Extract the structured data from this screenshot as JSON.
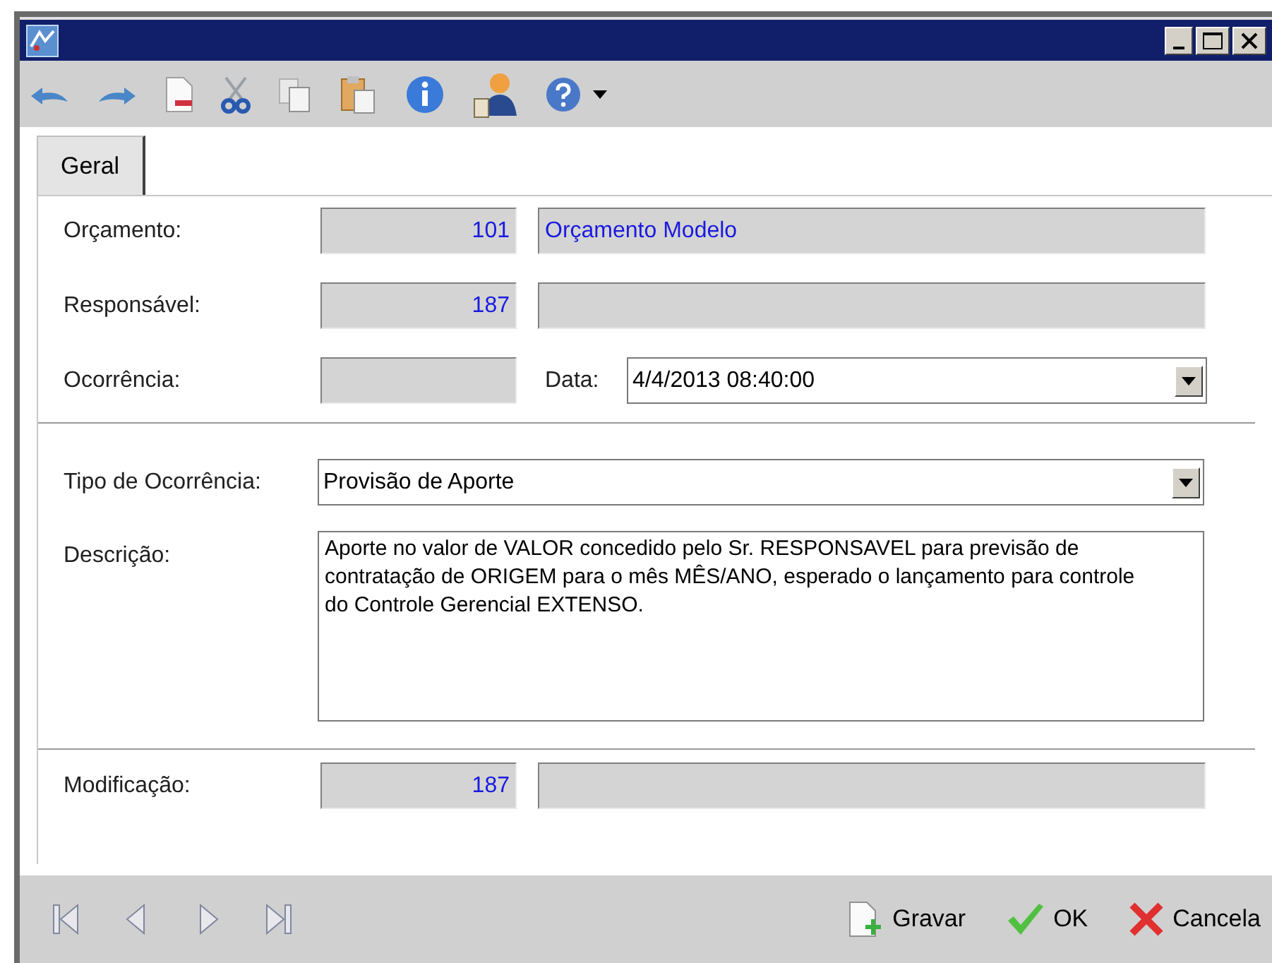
{
  "tabs": [
    {
      "label": "Geral",
      "selected": true
    }
  ],
  "rows": [
    {
      "kind": "code_name",
      "label": "Orçamento:",
      "code": "101",
      "name": "Orçamento Modelo"
    },
    {
      "kind": "code_name",
      "label": "Responsável:",
      "code": "187"
    },
    {
      "kind": "code_date",
      "label": "Ocorrência:",
      "date_label": "Data:",
      "date": "4/4/2013 08:40:00"
    },
    {
      "kind": "separator"
    },
    {
      "kind": "combo",
      "label": "Tipo de Ocorrência:",
      "value": "Provisão de Aporte"
    },
    {
      "kind": "memo",
      "label": "Descrição:",
      "value": "Aporte no valor de VALOR concedido pelo Sr. RESPONSAVEL para previsão de contratação de ORIGEM para o mês MÊS/ANO, esperado o lançamento para controle do Controle Gerencial EXTENSO."
    },
    {
      "kind": "separator"
    },
    {
      "kind": "code_name",
      "label": "Modificação:",
      "code": "187"
    }
  ],
  "actions": [
    {
      "kind": "save",
      "label": "Gravar"
    },
    {
      "kind": "ok",
      "label": "OK"
    },
    {
      "kind": "cancel",
      "label": "Cancela"
    }
  ]
}
